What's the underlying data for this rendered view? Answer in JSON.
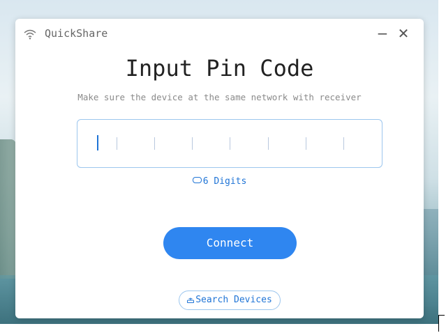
{
  "window": {
    "title": "QuickShare",
    "minimize_label": "−",
    "close_label": "✕"
  },
  "main": {
    "heading": "Input Pin Code",
    "subheading": "Make sure the device at the same network with receiver",
    "pin": {
      "value": "",
      "length": 6
    },
    "digits_hint": "6 Digits",
    "connect_label": "Connect",
    "search_label": "Search Devices"
  },
  "colors": {
    "accent": "#2f86f0",
    "accent_text": "#1f74d6",
    "border": "#9cc6ee"
  }
}
